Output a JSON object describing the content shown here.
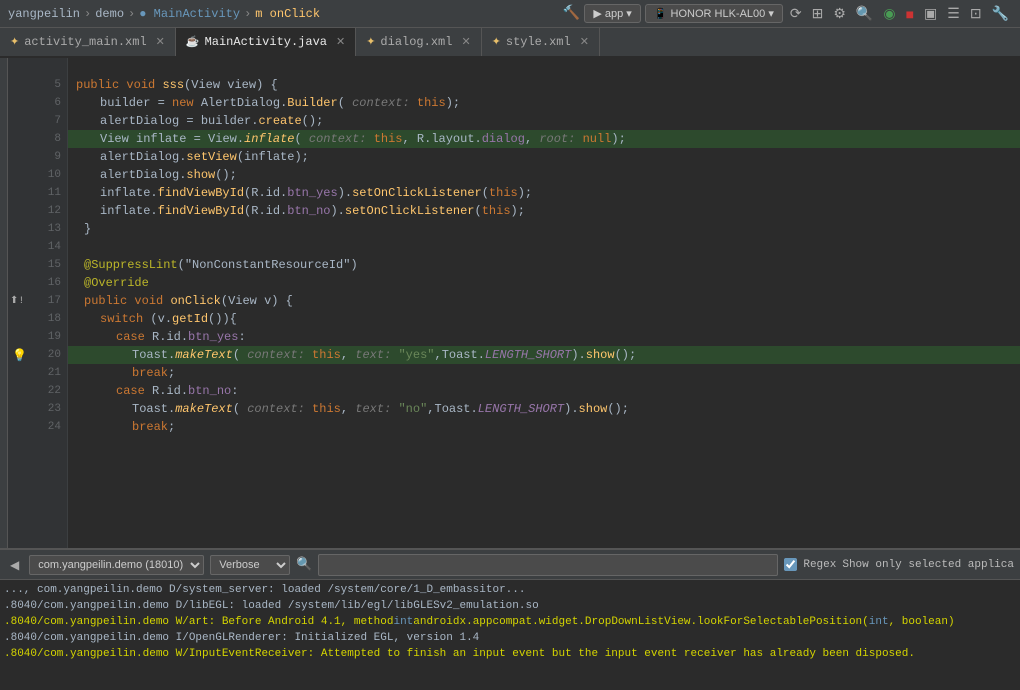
{
  "topbar": {
    "breadcrumbs": [
      {
        "label": "yangpeilin",
        "style": "plain"
      },
      {
        "label": ">",
        "style": "sep"
      },
      {
        "label": "demo",
        "style": "plain"
      },
      {
        "label": ">",
        "style": "sep"
      },
      {
        "label": "MainActivity",
        "style": "blue"
      },
      {
        "label": ">",
        "style": "sep"
      },
      {
        "label": "onClick",
        "style": "orange"
      }
    ],
    "app_selector": "app",
    "device_selector": "HONOR HLK-AL00",
    "icons": [
      "▶",
      "⟳",
      "⚙",
      "◀",
      "◉",
      "⏸",
      "■",
      "▣",
      "☰",
      "⊡",
      "⊞"
    ]
  },
  "tabs": [
    {
      "label": "activity_main.xml",
      "icon": "xml",
      "active": false,
      "closeable": true
    },
    {
      "label": "MainActivity.java",
      "icon": "java",
      "active": true,
      "closeable": true
    },
    {
      "label": "dialog.xml",
      "icon": "xml",
      "active": false,
      "closeable": true
    },
    {
      "label": "style.xml",
      "icon": "xml",
      "active": false,
      "closeable": true
    }
  ],
  "code_lines": [
    {
      "num": "",
      "content": ""
    },
    {
      "num": "5",
      "content": "    public void sss(View view) {"
    },
    {
      "num": "6",
      "content": "        builder = new AlertDialog.Builder( context: this);"
    },
    {
      "num": "7",
      "content": "        alertDialog = builder.create();"
    },
    {
      "num": "8",
      "content": "        View inflate = View.inflate( context: this, R.layout.dialog,  root: null);"
    },
    {
      "num": "9",
      "content": "        alertDialog.setView(inflate);"
    },
    {
      "num": "10",
      "content": "        alertDialog.show();"
    },
    {
      "num": "11",
      "content": "        inflate.findViewById(R.id.btn_yes).setOnClickListener(this);"
    },
    {
      "num": "12",
      "content": "        inflate.findViewById(R.id.btn_no).setOnClickListener(this);"
    },
    {
      "num": "13",
      "content": "    }"
    },
    {
      "num": "14",
      "content": ""
    },
    {
      "num": "15",
      "content": "    @SuppressLint(\"NonConstantResourceId\")"
    },
    {
      "num": "16",
      "content": "    @Override"
    },
    {
      "num": "17",
      "content": "    public void onClick(View v) {"
    },
    {
      "num": "18",
      "content": "        switch (v.getId()){"
    },
    {
      "num": "19",
      "content": "            case R.id.btn_yes:"
    },
    {
      "num": "20",
      "content": "                Toast.makeText( context: this, text: \"yes\",Toast.LENGTH_SHORT).show();"
    },
    {
      "num": "21",
      "content": "                break;"
    },
    {
      "num": "22",
      "content": "            case R.id.btn_no:"
    },
    {
      "num": "23",
      "content": "                Toast.makeText( context: this, text: \"no\",Toast.LENGTH_SHORT).show();"
    },
    {
      "num": "24",
      "content": "                break;"
    }
  ],
  "logbar": {
    "app_selector_value": "com.yangpeilin.demo (18010)",
    "log_level": "Verbose",
    "search_placeholder": "",
    "regex_label": "Regex",
    "show_only_label": "Show only selected applica",
    "regex_checked": true
  },
  "log_lines": [
    {
      "text": "..., com.yangpeilin.demo D/system_server: loaded /system/core/1_D_embassitor...",
      "type": "info"
    },
    {
      "text": ".8040/com.yangpeilin.demo D/libEGL: loaded /system/lib/egl/libGLESv2_emulation.so",
      "type": "info"
    },
    {
      "text": ".8040/com.yangpeilin.demo W/art: Before Android 4.1, method int androidx.appcompat.widget.DropDownListView.lookForSelectablePosition(int, boolean)",
      "type": "warning"
    },
    {
      "text": ".8040/com.yangpeilin.demo I/OpenGLRenderer: Initialized EGL, version 1.4",
      "type": "info"
    },
    {
      "text": ".8040/com.yangpeilin.demo W/InputEventReceiver: Attempted to finish an input event but the input event receiver has already been disposed.",
      "type": "warning"
    }
  ]
}
